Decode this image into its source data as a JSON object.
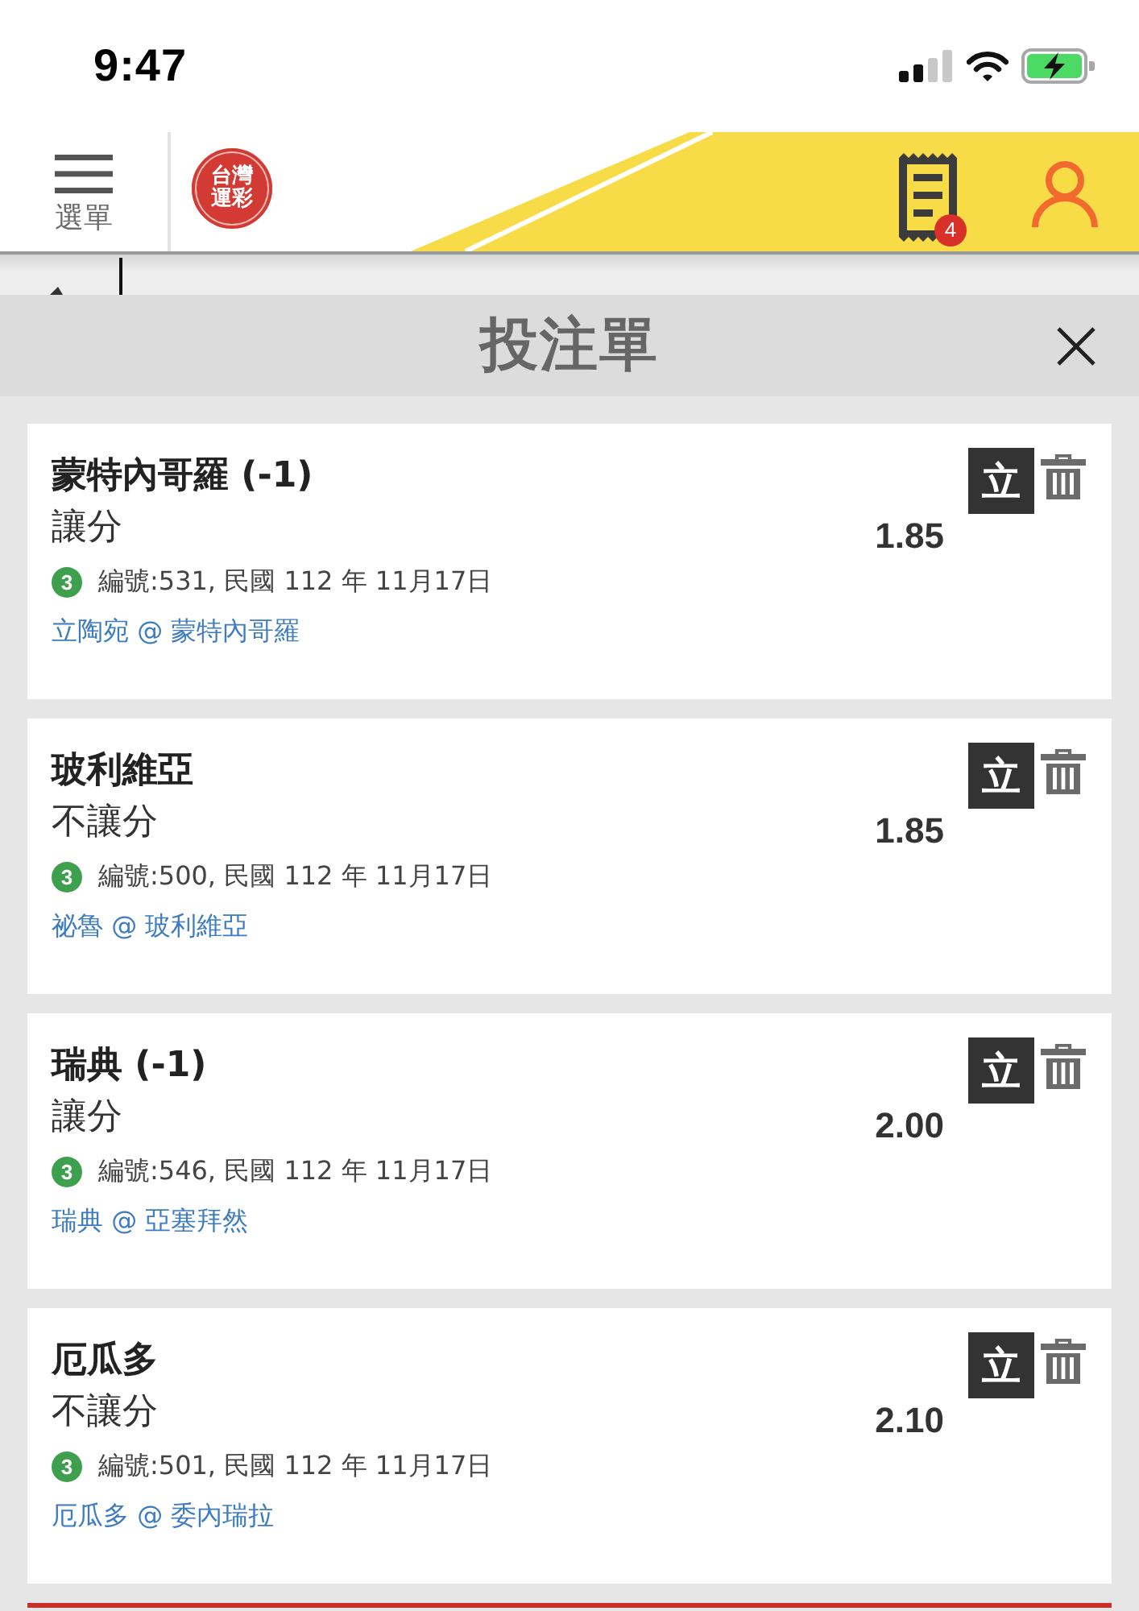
{
  "status_bar": {
    "time": "9:47"
  },
  "header": {
    "menu_label": "選單",
    "logo_lines": [
      "台灣",
      "運彩"
    ],
    "bet_slip_count": "4"
  },
  "bet_slip": {
    "title": "投注單"
  },
  "bets": [
    {
      "selection": "蒙特內哥羅 (-1)",
      "market": "讓分",
      "odds": "1.85",
      "single_label": "立",
      "badge": "3",
      "info": "編號:531, 民國 112 年 11月17日",
      "match": "立陶宛 @ 蒙特內哥羅"
    },
    {
      "selection": "玻利維亞",
      "market": "不讓分",
      "odds": "1.85",
      "single_label": "立",
      "badge": "3",
      "info": "編號:500, 民國 112 年 11月17日",
      "match": "祕魯 @ 玻利維亞"
    },
    {
      "selection": "瑞典 (-1)",
      "market": "讓分",
      "odds": "2.00",
      "single_label": "立",
      "badge": "3",
      "info": "編號:546, 民國 112 年 11月17日",
      "match": "瑞典 @ 亞塞拜然"
    },
    {
      "selection": "厄瓜多",
      "market": "不讓分",
      "odds": "2.10",
      "single_label": "立",
      "badge": "3",
      "info": "編號:501, 民國 112 年 11月17日",
      "match": "厄瓜多 @ 委內瑞拉"
    }
  ]
}
